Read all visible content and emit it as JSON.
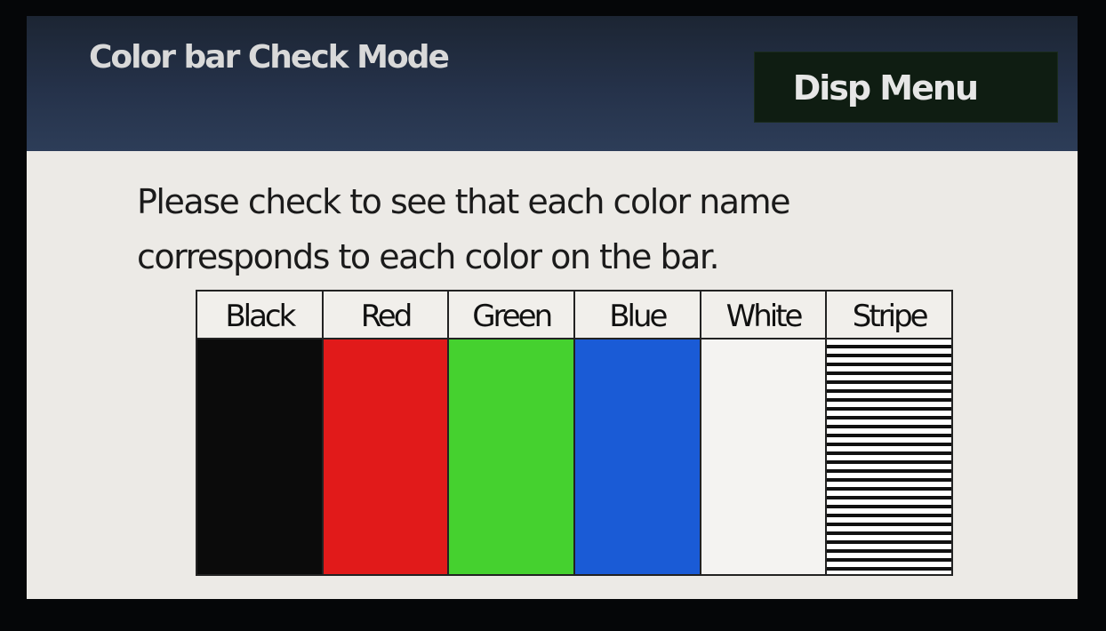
{
  "header": {
    "title": "Color bar Check Mode",
    "menu_button_label": "Disp Menu"
  },
  "instructions": {
    "line1": "Please check to see that each color name",
    "line2": "corresponds to each color on the bar."
  },
  "color_bars": [
    {
      "label": "Black",
      "color": "#0b0b0b"
    },
    {
      "label": "Red",
      "color": "#e11a1a"
    },
    {
      "label": "Green",
      "color": "#45d12f"
    },
    {
      "label": "Blue",
      "color": "#1a5bd6"
    },
    {
      "label": "White",
      "color": "#f4f3f1"
    },
    {
      "label": "Stripe",
      "color": "stripe"
    }
  ],
  "colors": {
    "header_bg": "#25324a",
    "button_bg": "#0f1d12",
    "content_bg": "#eceae6"
  }
}
